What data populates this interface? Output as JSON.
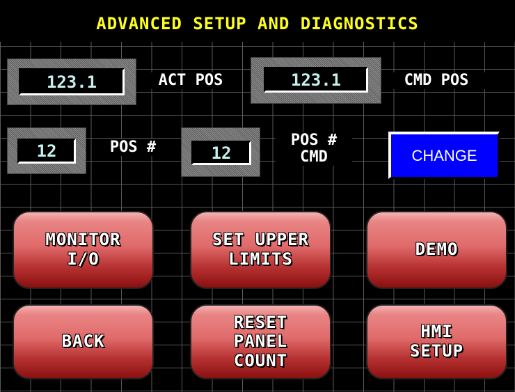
{
  "title": "ADVANCED SETUP AND DIAGNOSTICS",
  "fields": {
    "act_pos_value": "123.1",
    "act_pos_label": "ACT POS",
    "cmd_pos_value": "123.1",
    "cmd_pos_label": "CMD POS",
    "pos_num_value": "12",
    "pos_num_label": "POS #",
    "pos_num_cmd_value": "12",
    "pos_num_cmd_label": "POS #\nCMD"
  },
  "change_button": "CHANGE",
  "buttons": {
    "monitor_io": "MONITOR\nI/O",
    "set_upper_limits": "SET UPPER\nLIMITS",
    "demo": "DEMO",
    "back": "BACK",
    "reset_panel_count": "RESET\nPANEL\nCOUNT",
    "hmi_setup": "HMI\nSETUP"
  },
  "colors": {
    "title": "#ffff1e",
    "value_text": "#c6f0ec",
    "change_bg": "#0000ff",
    "button_red": "#b83333"
  }
}
